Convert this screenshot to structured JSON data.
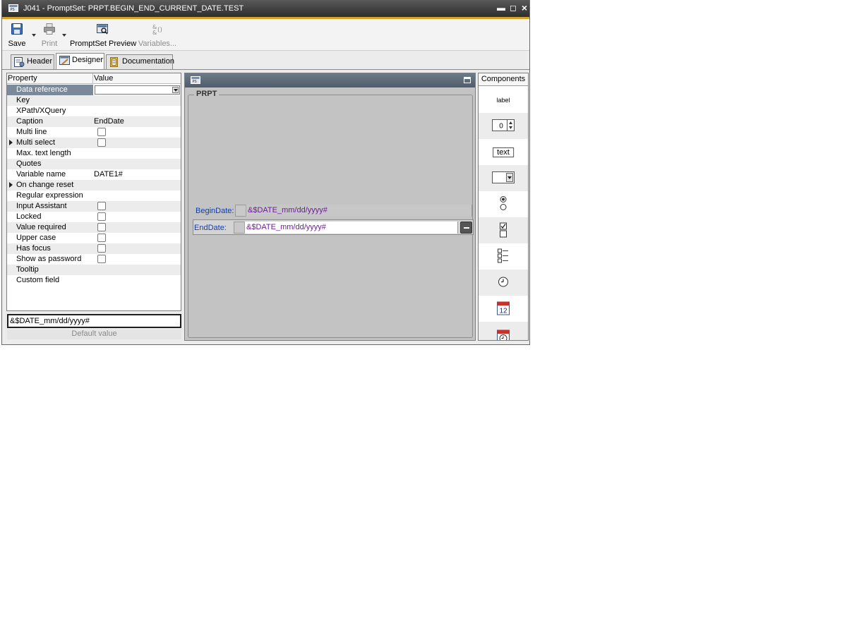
{
  "window": {
    "title": "J041 - PromptSet: PRPT.BEGIN_END_CURRENT_DATE.TEST",
    "controls": {
      "minimize": "▬",
      "maximize": "◻",
      "close": "×"
    }
  },
  "toolbar": {
    "save": "Save",
    "print": "Print",
    "preview": "PromptSet Preview",
    "variables": "Variables..."
  },
  "tabs": [
    {
      "label": "Header",
      "active": false
    },
    {
      "label": "Designer",
      "active": true
    },
    {
      "label": "Documentation",
      "active": false
    }
  ],
  "properties": {
    "header_property": "Property",
    "header_value": "Value",
    "rows": [
      {
        "name": "Data reference",
        "value": ""
      },
      {
        "name": "Key",
        "value": ""
      },
      {
        "name": "XPath/XQuery",
        "value": ""
      },
      {
        "name": "Caption",
        "value": "EndDate"
      },
      {
        "name": "Multi line",
        "value": ""
      },
      {
        "name": "Multi select",
        "value": ""
      },
      {
        "name": "Max. text length",
        "value": ""
      },
      {
        "name": "Quotes",
        "value": ""
      },
      {
        "name": "Variable name",
        "value": "DATE1#"
      },
      {
        "name": "On change reset",
        "value": ""
      },
      {
        "name": "Regular expression",
        "value": ""
      },
      {
        "name": "Input Assistant",
        "value": ""
      },
      {
        "name": "Locked",
        "value": ""
      },
      {
        "name": "Value required",
        "value": ""
      },
      {
        "name": "Upper case",
        "value": ""
      },
      {
        "name": "Has focus",
        "value": ""
      },
      {
        "name": "Show as password",
        "value": ""
      },
      {
        "name": "Tooltip",
        "value": ""
      },
      {
        "name": "Custom field",
        "value": ""
      }
    ],
    "default_value": "&$DATE_mm/dd/yyyy#",
    "default_value_label": "Default value"
  },
  "designer": {
    "frame_title": "PRPT",
    "fields": [
      {
        "label": "BeginDate:",
        "value": "&$DATE_mm/dd/yyyy#"
      },
      {
        "label": "EndDate:",
        "value": "&$DATE_mm/dd/yyyy#"
      }
    ]
  },
  "components": {
    "title": "Components",
    "label_text": "label",
    "number_value": "0",
    "text_text": "text",
    "calendar_day": "12"
  },
  "colors": {
    "title_bar": "#3a3a3a",
    "accent": "#d4a22a",
    "field_label": "#0e3db8",
    "field_value": "#6f1c9a",
    "designer_bg": "#c3c3c3"
  }
}
